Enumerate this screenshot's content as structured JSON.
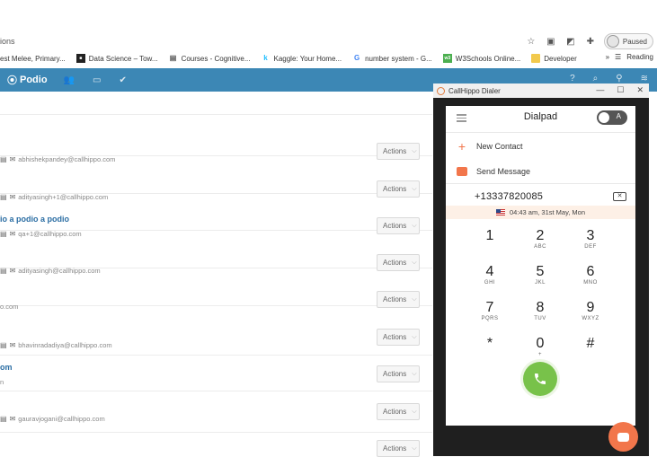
{
  "browser": {
    "address_text": "ions",
    "paused_label": "Paused",
    "bookmarks": [
      {
        "label": "est Melee, Primary...",
        "icon": "page-icon"
      },
      {
        "label": "Data Science – Tow...",
        "icon": "site-icon"
      },
      {
        "label": "Courses - Cognitive...",
        "icon": "page-icon"
      },
      {
        "label": "Kaggle: Your Home...",
        "icon": "kaggle-icon"
      },
      {
        "label": "number system - G...",
        "icon": "google-icon"
      },
      {
        "label": "W3Schools Online...",
        "icon": "w3-icon"
      },
      {
        "label": "Developer",
        "icon": "folder-icon"
      }
    ],
    "more_bookmarks": "»",
    "reading_list": "Reading"
  },
  "podio": {
    "logo": "Podio",
    "rows": [
      {
        "title": "",
        "meta": "abhishekpandey@callhippo.com",
        "action": "Actions"
      },
      {
        "title": "",
        "meta": "adityasingh+1@callhippo.com",
        "action": "Actions"
      },
      {
        "title": "io a podio a podio",
        "meta": "qa+1@callhippo.com",
        "action": "Actions"
      },
      {
        "title": "",
        "meta": "adityasingh@callhippo.com",
        "action": "Actions"
      },
      {
        "title": "",
        "meta": "o.com",
        "action": "Actions"
      },
      {
        "title": "",
        "meta": "bhavinradadiya@callhippo.com",
        "action": "Actions"
      },
      {
        "title": "om",
        "meta": "n",
        "action": "Actions"
      },
      {
        "title": "",
        "meta": "gauravjogani@callhippo.com",
        "action": "Actions"
      },
      {
        "title": "",
        "meta": "",
        "action": "Actions"
      }
    ]
  },
  "dialer": {
    "window_title": "CallHippo Dialer",
    "title": "Dialpad",
    "toggle_label": "A",
    "new_contact": "New Contact",
    "send_message": "Send Message",
    "number": "+13337820085",
    "time_text": "04:43 am, 31st May, Mon",
    "keys": [
      {
        "digit": "1",
        "letters": ""
      },
      {
        "digit": "2",
        "letters": "ABC"
      },
      {
        "digit": "3",
        "letters": "DEF"
      },
      {
        "digit": "4",
        "letters": "GHI"
      },
      {
        "digit": "5",
        "letters": "JKL"
      },
      {
        "digit": "6",
        "letters": "MNO"
      },
      {
        "digit": "7",
        "letters": "PQRS"
      },
      {
        "digit": "8",
        "letters": "TUV"
      },
      {
        "digit": "9",
        "letters": "WXYZ"
      },
      {
        "digit": "*",
        "letters": ""
      },
      {
        "digit": "0",
        "letters": "+"
      },
      {
        "digit": "#",
        "letters": ""
      }
    ]
  }
}
